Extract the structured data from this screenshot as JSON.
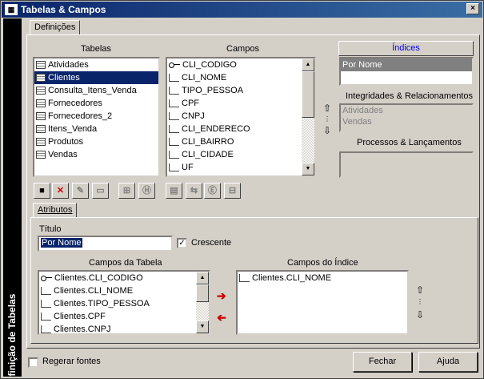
{
  "window": {
    "title": "Tabelas & Campos",
    "close_glyph": "×",
    "icon": "table-app-icon",
    "sidebar_text": "Definição de Tabelas"
  },
  "tabs": {
    "main": "Definições",
    "attrs": "Atributos"
  },
  "tabelas": {
    "label": "Tabelas",
    "items": [
      "Atividades",
      "Clientes",
      "Consulta_Itens_Venda",
      "Fornecedores",
      "Fornecedores_2",
      "Itens_Venda",
      "Produtos",
      "Vendas"
    ],
    "selected_index": 1
  },
  "campos": {
    "label": "Campos",
    "items": [
      "CLI_CODIGO",
      "CLI_NOME",
      "TIPO_PESSOA",
      "CPF",
      "CNPJ",
      "CLI_ENDERECO",
      "CLI_BAIRRO",
      "CLI_CIDADE",
      "UF"
    ],
    "key_index": 0
  },
  "indices": {
    "header": "Índices",
    "items": [
      "Por Nome"
    ],
    "selected_index": 0
  },
  "integridades": {
    "label": "Integridades & Relacionamentos",
    "items": [
      "Atividades",
      "Vendas"
    ]
  },
  "processos": {
    "label": "Processos & Lançamentos",
    "items": []
  },
  "toolbar": {
    "icons": [
      "save-icon",
      "delete-icon",
      "edit-icon",
      "rename-icon",
      "add-field-icon",
      "help-icon",
      "index-icon",
      "link-icon",
      "info-icon",
      "grid-icon"
    ]
  },
  "attrs": {
    "titulo_label": "Título",
    "titulo_value": "Por Nome",
    "crescente_label": "Crescente",
    "crescente_checked": true,
    "campos_tabela_label": "Campos da Tabela",
    "campos_tabela": [
      "Clientes.CLI_CODIGO",
      "Clientes.CLI_NOME",
      "Clientes.TIPO_PESSOA",
      "Clientes.CPF",
      "Clientes.CNPJ"
    ],
    "campos_indice_label": "Campos do Índice",
    "campos_indice": [
      "Clientes.CLI_NOME"
    ]
  },
  "footer": {
    "regerar_label": "Regerar fontes",
    "regerar_checked": false,
    "fechar": "Fechar",
    "ajuda": "Ajuda"
  },
  "colors": {
    "title_start": "#0a246a",
    "title_end": "#3a6ea5",
    "face": "#d4d0c8",
    "selection": "#0a246a",
    "arrow_red": "#cc0000"
  }
}
